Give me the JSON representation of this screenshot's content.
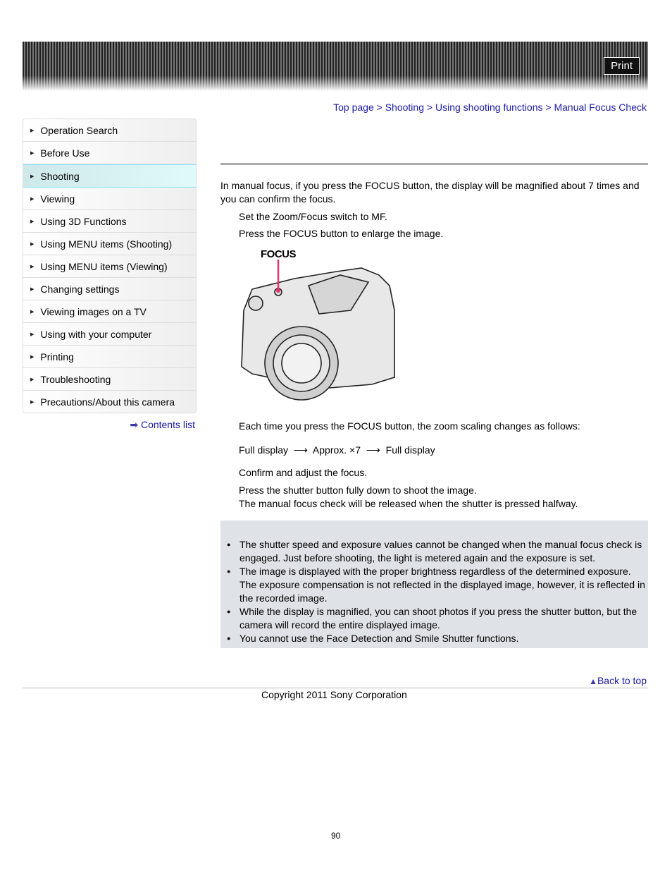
{
  "header": {
    "print_label": "Print"
  },
  "breadcrumb": [
    "Top page",
    "Shooting",
    "Using shooting functions",
    "Manual Focus Check"
  ],
  "breadcrumb_sep": " > ",
  "sidebar": {
    "items": [
      "Operation Search",
      "Before Use",
      "Shooting",
      "Viewing",
      "Using 3D Functions",
      "Using MENU items (Shooting)",
      "Using MENU items (Viewing)",
      "Changing settings",
      "Viewing images on a TV",
      "Using with your computer",
      "Printing",
      "Troubleshooting",
      "Precautions/About this camera"
    ],
    "active": "Shooting",
    "contents_link": "Contents list"
  },
  "main": {
    "intro": "In manual focus, if you press the FOCUS button, the display will be magnified about 7 times and you can confirm the focus.",
    "step1": "Set the Zoom/Focus switch to MF.",
    "step2": "Press the FOCUS button to enlarge the image.",
    "figure_label": "FOCUS",
    "step2_note": "Each time you press the FOCUS button, the zoom scaling changes as follows:",
    "sequence": [
      "Full display",
      "Approx. ×7",
      "Full display"
    ],
    "step3": "Confirm and adjust the focus.",
    "step4": "Press the shutter button fully down to shoot the image.",
    "step4_note": "The manual focus check will be released when the shutter is pressed halfway.",
    "notes": [
      "The shutter speed and exposure values cannot be changed when the manual focus check is engaged. Just before shooting, the light is metered again and the exposure is set.",
      "The image is displayed with the proper brightness regardless of the determined exposure. The exposure compensation is not reflected in the displayed image, however, it is reflected in the recorded image.",
      "While the display is magnified, you can shoot photos if you press the shutter button, but the camera will record the entire displayed image.",
      "You cannot use the Face Detection and Smile Shutter functions."
    ]
  },
  "footer": {
    "back_to_top": "Back to top",
    "copyright": "Copyright 2011 Sony Corporation",
    "page_number": "90"
  },
  "colors": {
    "link": "#1a1aa6",
    "active_item": "#e0f9fb",
    "note_bg": "#dfe2e6",
    "focus_marker": "#e8336e"
  }
}
